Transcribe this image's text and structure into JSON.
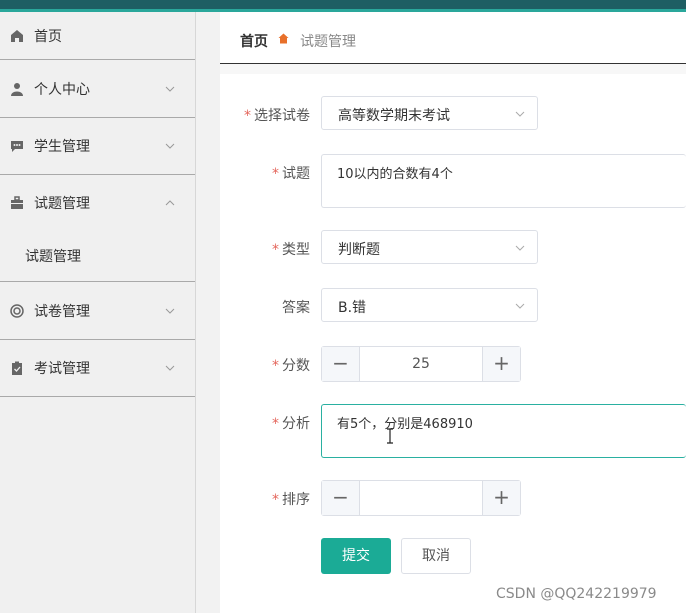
{
  "sidebar": {
    "items": [
      {
        "label": "首页",
        "icon": "home-icon"
      },
      {
        "label": "个人中心",
        "icon": "user-icon"
      },
      {
        "label": "学生管理",
        "icon": "chat-icon"
      },
      {
        "label": "试题管理",
        "icon": "briefcase-icon",
        "expanded": true,
        "children": [
          {
            "label": "试题管理"
          }
        ]
      },
      {
        "label": "试卷管理",
        "icon": "circle-icon"
      },
      {
        "label": "考试管理",
        "icon": "clipboard-icon"
      }
    ]
  },
  "breadcrumb": {
    "home": "首页",
    "current": "试题管理"
  },
  "form": {
    "paper": {
      "label": "选择试卷",
      "value": "高等数学期末考试",
      "required": true
    },
    "question": {
      "label": "试题",
      "value": "10以内的合数有4个",
      "required": true
    },
    "type": {
      "label": "类型",
      "value": "判断题",
      "required": true
    },
    "answer": {
      "label": "答案",
      "value": "B.错",
      "required": false
    },
    "score": {
      "label": "分数",
      "value": "25",
      "required": true
    },
    "analysis": {
      "label": "分析",
      "value": "有5个，分别是468910",
      "required": true
    },
    "order": {
      "label": "排序",
      "value": "",
      "required": true
    },
    "required_mark": "*",
    "submit": "提交",
    "cancel": "取消"
  },
  "watermark": "CSDN @QQ242219979",
  "colors": {
    "accent": "#1bab96",
    "topbar": "#1e5e63",
    "required": "#e4655b"
  }
}
